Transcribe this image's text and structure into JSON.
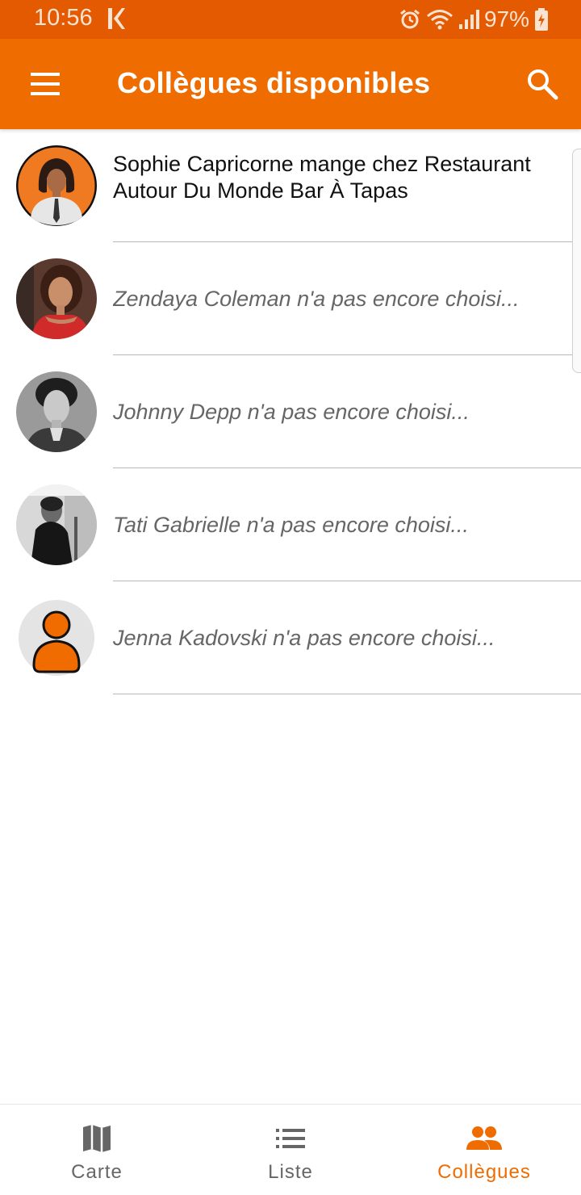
{
  "status_bar": {
    "time": "10:56",
    "battery": "97%",
    "icons": [
      "kustom-k-icon",
      "alarm-icon",
      "wifi-icon",
      "signal-icon",
      "battery-charging-icon"
    ]
  },
  "app_bar": {
    "title": "Collègues disponibles",
    "menu_icon": "hamburger-menu-icon",
    "search_icon": "search-icon"
  },
  "colleagues": [
    {
      "text": "Sophie Capricorne mange chez Restaurant Autour Du Monde Bar À Tapas",
      "state": "chosen",
      "avatar": "female-cartoon-avatar"
    },
    {
      "text": "Zendaya Coleman n'a pas encore choisi...",
      "state": "pending",
      "avatar": "photo-avatar"
    },
    {
      "text": "Johnny Depp n'a pas encore choisi...",
      "state": "pending",
      "avatar": "photo-avatar"
    },
    {
      "text": "Tati Gabrielle n'a pas encore choisi...",
      "state": "pending",
      "avatar": "photo-avatar"
    },
    {
      "text": "Jenna Kadovski n'a pas encore choisi...",
      "state": "pending",
      "avatar": "default-person-avatar"
    }
  ],
  "bottom_nav": [
    {
      "label": "Carte",
      "icon": "map-icon",
      "active": false
    },
    {
      "label": "Liste",
      "icon": "list-icon",
      "active": false
    },
    {
      "label": "Collègues",
      "icon": "people-icon",
      "active": true
    }
  ],
  "colors": {
    "status_bar": "#e35a00",
    "primary": "#ef6c00",
    "inactive": "#666666"
  }
}
